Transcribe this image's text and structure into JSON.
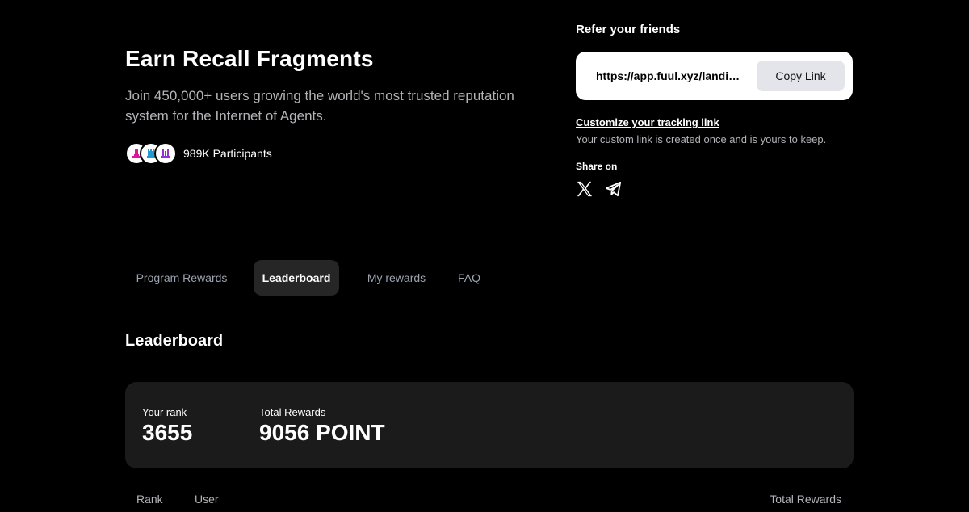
{
  "hero": {
    "title": "Earn Recall Fragments",
    "subtitle": "Join 450,000+ users growing the world's most trusted reputation system for the Internet of Agents.",
    "participants": "989K Participants",
    "avatar_colors": [
      "#e0169a",
      "#1f9ad6",
      "#9b2fd6"
    ]
  },
  "referral": {
    "title": "Refer your friends",
    "link": "https://app.fuul.xyz/landing/recall?referrer=",
    "copy_label": "Copy Link",
    "customize_label": "Customize your tracking link",
    "customize_note": "Your custom link is created once and is yours to keep.",
    "share_label": "Share on",
    "share_icons": [
      "x-icon",
      "telegram-icon"
    ]
  },
  "tabs": [
    {
      "label": "Program Rewards",
      "active": false
    },
    {
      "label": "Leaderboard",
      "active": true
    },
    {
      "label": "My rewards",
      "active": false
    },
    {
      "label": "FAQ",
      "active": false
    }
  ],
  "leaderboard": {
    "title": "Leaderboard",
    "your_rank_label": "Your rank",
    "your_rank_value": "3655",
    "total_rewards_label": "Total Rewards",
    "total_rewards_value": "9056 POINT",
    "columns": [
      "Rank",
      "User",
      "Total Rewards"
    ]
  },
  "colors": {
    "background": "#000000",
    "card": "#1b1b1b",
    "active_tab": "#262626",
    "muted_text": "#9ea3b0"
  }
}
